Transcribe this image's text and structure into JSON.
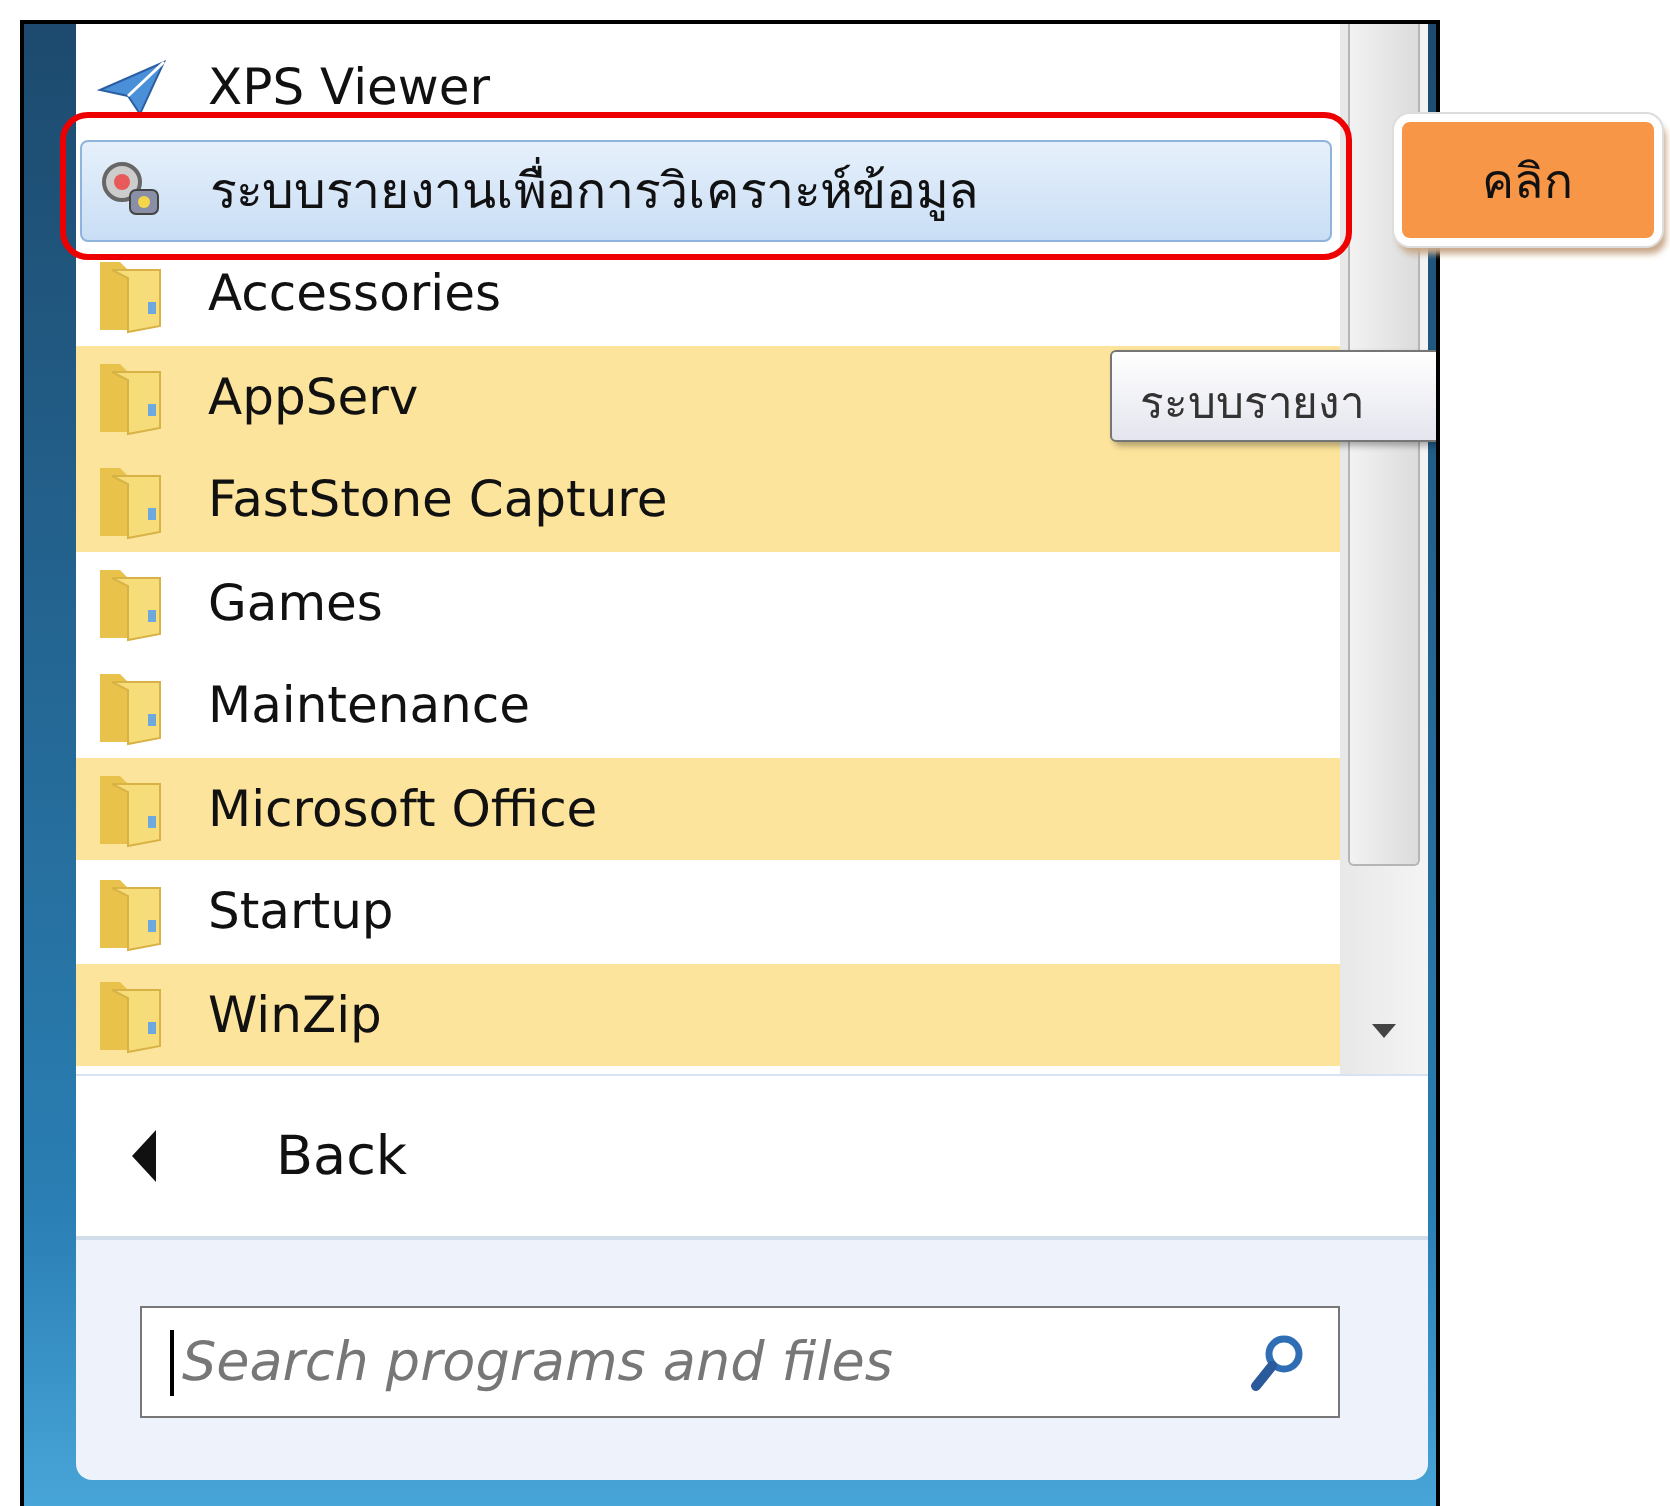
{
  "programs": [
    {
      "label": "XPS Viewer",
      "kind": "xps",
      "new": false,
      "selected": false
    },
    {
      "label": "ระบบรายงานเพื่อการวิเคราะห์ข้อมูล",
      "kind": "app",
      "new": false,
      "selected": true
    },
    {
      "label": "Accessories",
      "kind": "folder",
      "new": false,
      "selected": false
    },
    {
      "label": "AppServ",
      "kind": "folder",
      "new": true,
      "selected": false
    },
    {
      "label": "FastStone Capture",
      "kind": "folder",
      "new": true,
      "selected": false
    },
    {
      "label": "Games",
      "kind": "folder",
      "new": false,
      "selected": false
    },
    {
      "label": "Maintenance",
      "kind": "folder",
      "new": false,
      "selected": false
    },
    {
      "label": "Microsoft Office",
      "kind": "folder",
      "new": true,
      "selected": false
    },
    {
      "label": "Startup",
      "kind": "folder",
      "new": false,
      "selected": false
    },
    {
      "label": "WinZip",
      "kind": "folder",
      "new": true,
      "selected": false
    }
  ],
  "back": {
    "label": "Back"
  },
  "search": {
    "placeholder": "Search programs and files"
  },
  "tooltip": {
    "text": "ระบบรายงา"
  },
  "callout": {
    "text": "คลิก"
  }
}
